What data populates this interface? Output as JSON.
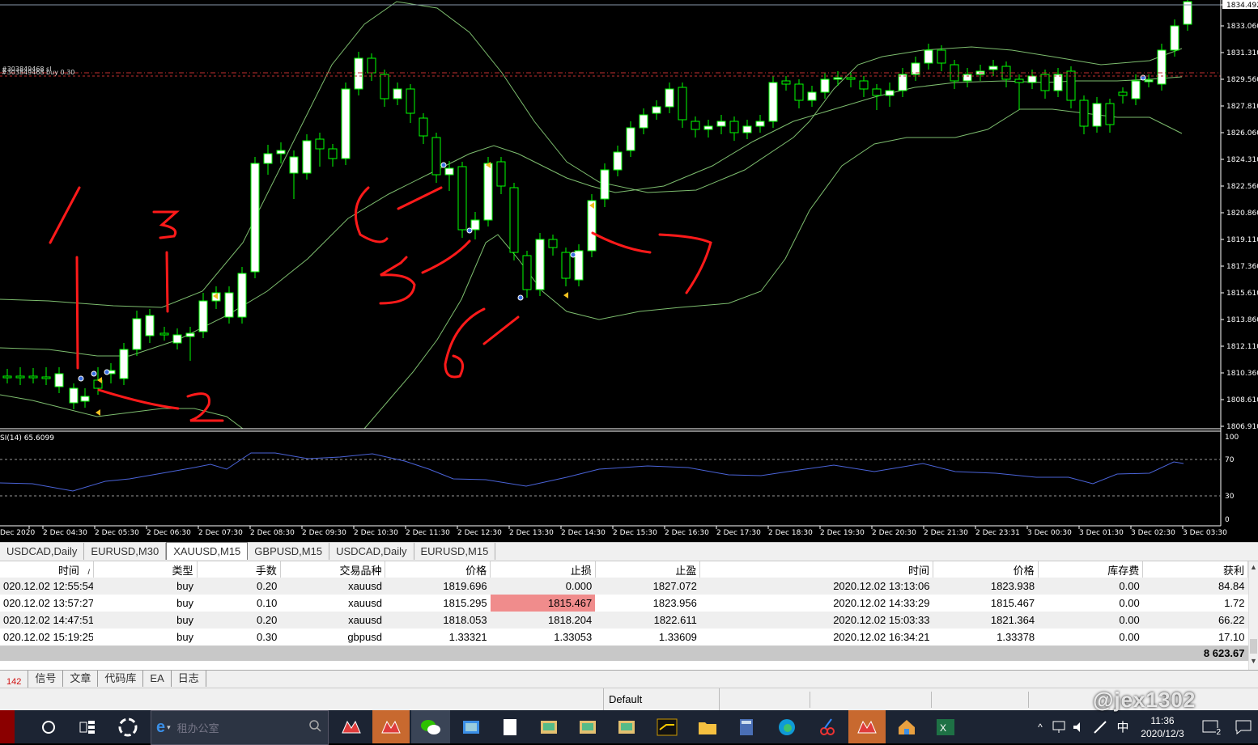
{
  "chart": {
    "price_levels": [
      "1834.492",
      "1833.060",
      "1831.310",
      "1829.560",
      "1827.810",
      "1826.060",
      "1824.310",
      "1822.560",
      "1820.860",
      "1819.110",
      "1817.360",
      "1815.610",
      "1813.860",
      "1812.110",
      "1810.360",
      "1808.610",
      "1806.910"
    ],
    "time_labels": [
      "Dec 2020",
      "2 Dec 04:30",
      "2 Dec 05:30",
      "2 Dec 06:30",
      "2 Dec 07:30",
      "2 Dec 08:30",
      "2 Dec 09:30",
      "2 Dec 10:30",
      "2 Dec 11:30",
      "2 Dec 12:30",
      "2 Dec 13:30",
      "2 Dec 14:30",
      "2 Dec 15:30",
      "2 Dec 16:30",
      "2 Dec 17:30",
      "2 Dec 18:30",
      "2 Dec 19:30",
      "2 Dec 20:30",
      "2 Dec 21:30",
      "2 Dec 23:31",
      "3 Dec 00:30",
      "3 Dec 01:30",
      "3 Dec 02:30",
      "3 Dec 03:30"
    ],
    "order_line_label_1": "#303849468 sl",
    "order_line_label_2": "#303849468 buy 0.30",
    "rsi_label": "SI(14) 65.6099",
    "rsi_levels": [
      "100",
      "70",
      "30",
      "0"
    ],
    "annotations": [
      "1",
      "2",
      "3",
      "4",
      "5",
      "6",
      "7"
    ]
  },
  "symbol_tabs": [
    "USDCAD,Daily",
    "EURUSD,M30",
    "XAUUSD,M15",
    "GBPUSD,M15",
    "USDCAD,Daily",
    "EURUSD,M15"
  ],
  "active_tab_index": 2,
  "orders": {
    "headers": [
      "时间",
      "类型",
      "手数",
      "交易品种",
      "价格",
      "止损",
      "止盈",
      "时间",
      "价格",
      "库存费",
      "获利"
    ],
    "sort_indicator": "/",
    "rows": [
      [
        "020.12.02 12:55:54",
        "buy",
        "0.20",
        "xauusd",
        "1819.696",
        "0.000",
        "1827.072",
        "2020.12.02 13:13:06",
        "1823.938",
        "0.00",
        "84.84"
      ],
      [
        "020.12.02 13:57:27",
        "buy",
        "0.10",
        "xauusd",
        "1815.295",
        "1815.467",
        "1823.956",
        "2020.12.02 14:33:29",
        "1815.467",
        "0.00",
        "1.72"
      ],
      [
        "020.12.02 14:47:51",
        "buy",
        "0.20",
        "xauusd",
        "1818.053",
        "1818.204",
        "1822.611",
        "2020.12.02 15:03:33",
        "1821.364",
        "0.00",
        "66.22"
      ],
      [
        "020.12.02 15:19:25",
        "buy",
        "0.30",
        "gbpusd",
        "1.33321",
        "1.33053",
        "1.33609",
        "2020.12.02 16:34:21",
        "1.33378",
        "0.00",
        "17.10"
      ]
    ],
    "total": "8 623.67",
    "highlight_color": "#f08c8c"
  },
  "bottom_tabs": [
    "142",
    "信号",
    "文章",
    "代码库",
    "EA",
    "日志"
  ],
  "status": {
    "profile": "Default"
  },
  "taskbar": {
    "search_placeholder": "租办公室",
    "clock_time": "11:36",
    "clock_date": "2020/12/3",
    "ime": "中",
    "notification_count": "2",
    "watermark": "@jex1302"
  },
  "colors": {
    "bull_candle": "#ffffff",
    "bear_candle": "#000000",
    "candle_outline": "#00ff00",
    "bollinger": "#7dbd6e",
    "rsi_line": "#4a63d8",
    "annotation": "#ff1a1a"
  }
}
